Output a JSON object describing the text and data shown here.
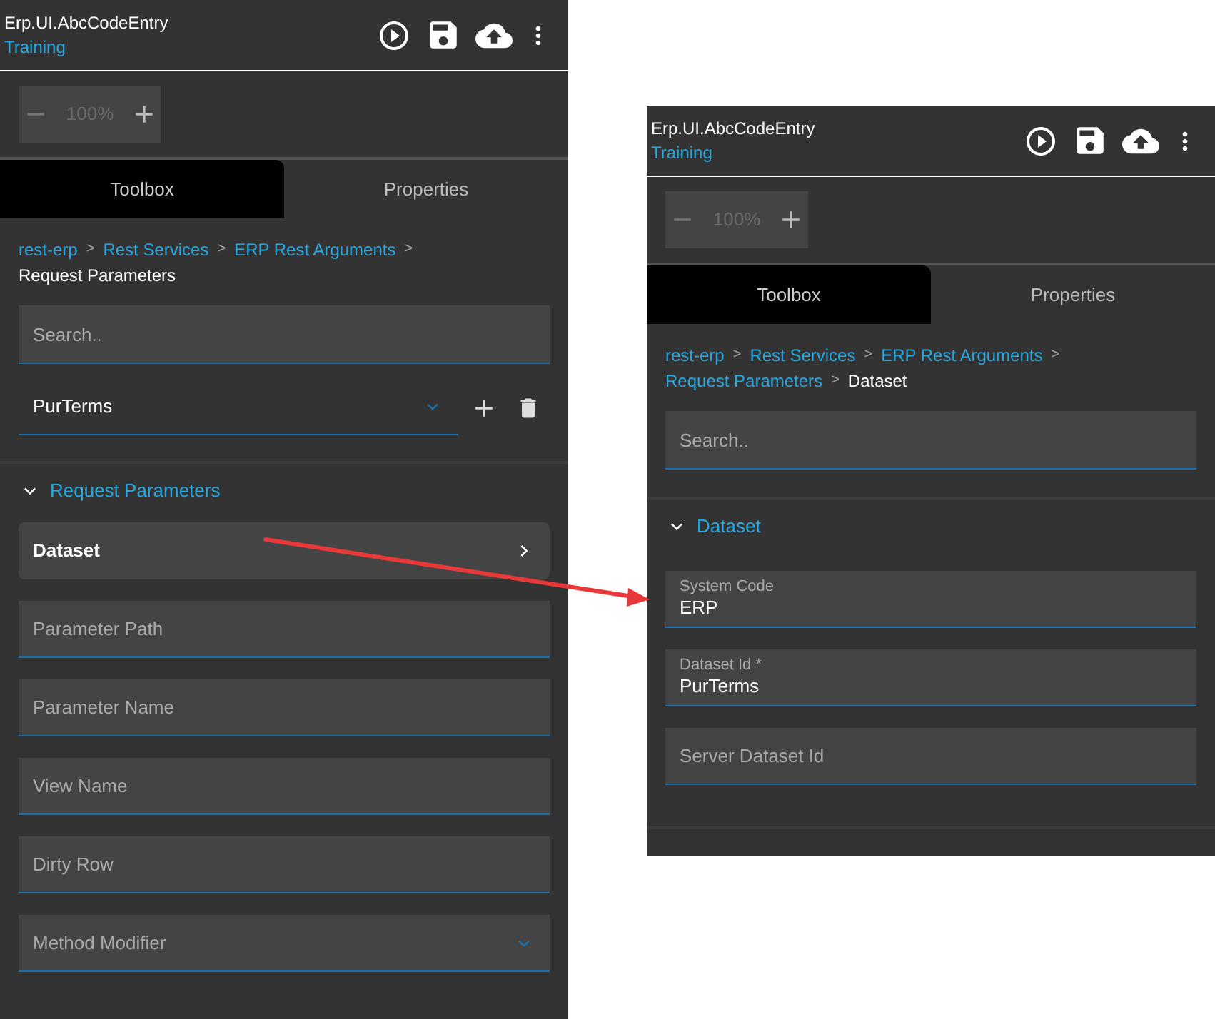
{
  "panels": [
    {
      "header": {
        "title": "Erp.UI.AbcCodeEntry",
        "subtitle": "Training"
      },
      "zoom": {
        "value": "100%"
      },
      "tabs": [
        {
          "label": "Toolbox",
          "selected": true
        },
        {
          "label": "Properties",
          "selected": false
        }
      ],
      "breadcrumb": {
        "separator": ">",
        "items": [
          {
            "label": "rest-erp",
            "current": false
          },
          {
            "label": "Rest Services",
            "current": false
          },
          {
            "label": "ERP Rest Arguments",
            "current": false
          },
          {
            "label": "Request Parameters",
            "current": true
          }
        ]
      },
      "search": {
        "placeholder": "Search.."
      },
      "picker": {
        "value": "PurTerms"
      },
      "section": {
        "title": "Request Parameters",
        "expanded": true
      },
      "fields": [
        {
          "kind": "nav",
          "label": "Dataset"
        },
        {
          "kind": "text",
          "placeholder": "Parameter Path"
        },
        {
          "kind": "text",
          "placeholder": "Parameter Name"
        },
        {
          "kind": "text",
          "placeholder": "View Name"
        },
        {
          "kind": "text",
          "placeholder": "Dirty Row"
        },
        {
          "kind": "select",
          "placeholder": "Method Modifier"
        }
      ]
    },
    {
      "header": {
        "title": "Erp.UI.AbcCodeEntry",
        "subtitle": "Training"
      },
      "zoom": {
        "value": "100%"
      },
      "tabs": [
        {
          "label": "Toolbox",
          "selected": true
        },
        {
          "label": "Properties",
          "selected": false
        }
      ],
      "breadcrumb": {
        "separator": ">",
        "items": [
          {
            "label": "rest-erp",
            "current": false
          },
          {
            "label": "Rest Services",
            "current": false
          },
          {
            "label": "ERP Rest Arguments",
            "current": false
          },
          {
            "label": "Request Parameters",
            "current": false
          },
          {
            "label": "Dataset",
            "current": true
          }
        ]
      },
      "search": {
        "placeholder": "Search.."
      },
      "section": {
        "title": "Dataset",
        "expanded": true
      },
      "fields": [
        {
          "kind": "text",
          "label": "System Code",
          "value": "ERP"
        },
        {
          "kind": "text",
          "label": "Dataset Id *",
          "value": "PurTerms"
        },
        {
          "kind": "text",
          "placeholder": "Server Dataset Id"
        }
      ]
    }
  ]
}
